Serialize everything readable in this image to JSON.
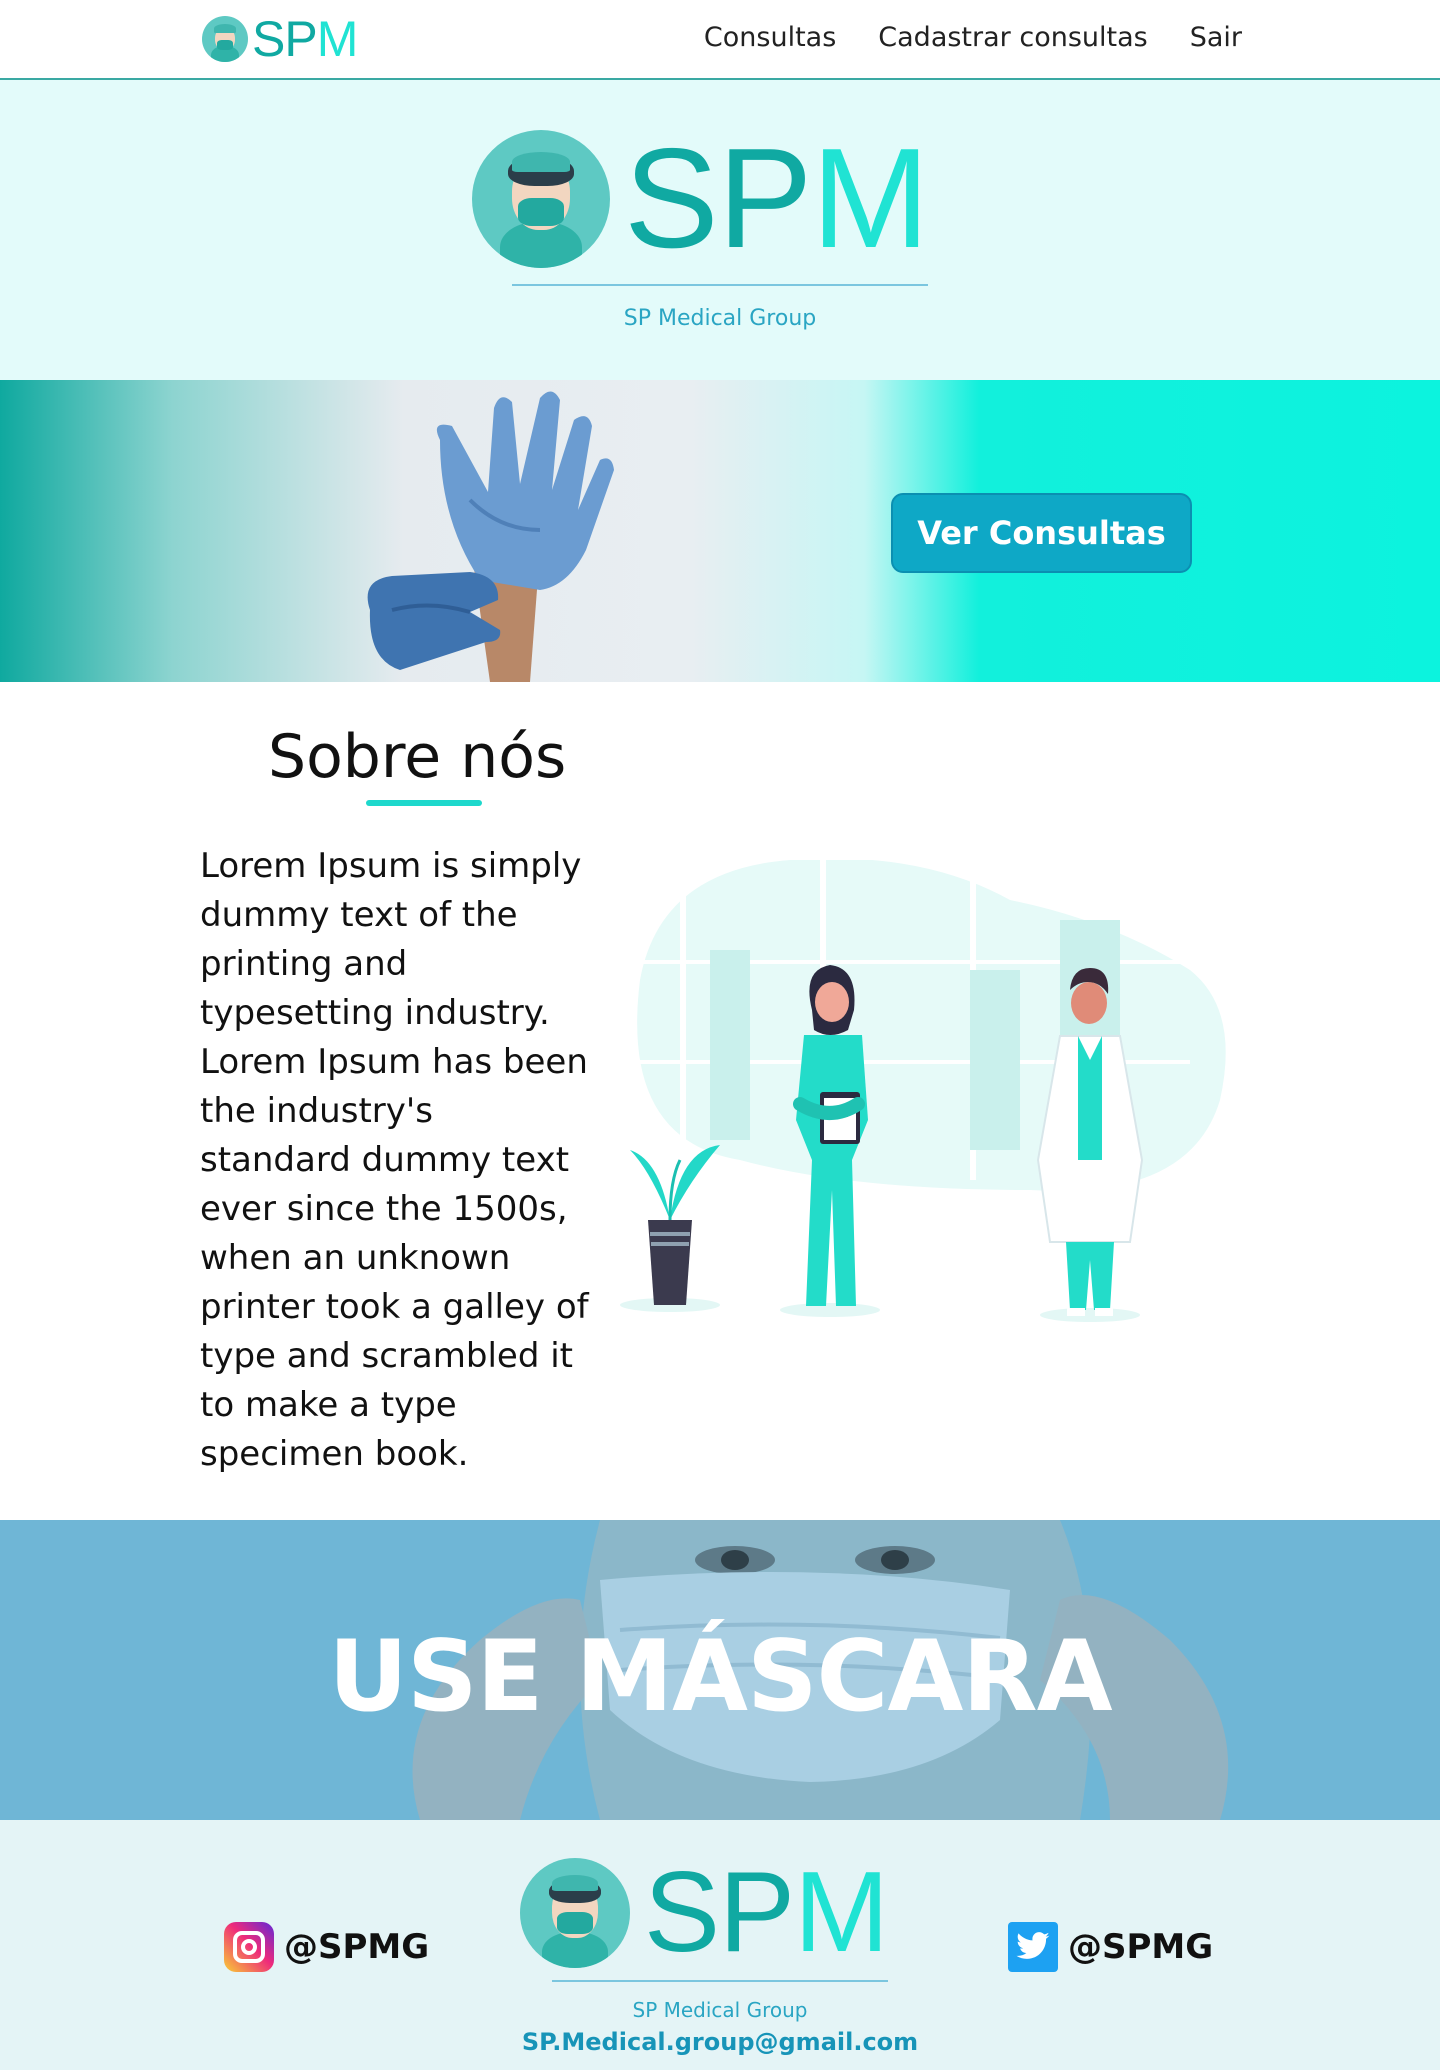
{
  "nav": {
    "logo_s": "SP",
    "logo_m": "M",
    "links": [
      "Consultas",
      "Cadastrar consultas",
      "Sair"
    ]
  },
  "brand": {
    "word_s": "SP",
    "word_m": "M",
    "subtitle": "SP Medical Group"
  },
  "banner": {
    "button_label": "Ver Consultas"
  },
  "about": {
    "title": "Sobre nós",
    "text": "Lorem Ipsum is simply dummy text of the printing and typesetting industry. Lorem Ipsum has been the industry's standard dummy text ever since the 1500s, when an unknown printer took a galley of type and scrambled it to make a type specimen book."
  },
  "mask_banner": {
    "title": "USE MÁSCARA"
  },
  "footer": {
    "instagram_handle": "@SPMG",
    "twitter_handle": "@SPMG",
    "logo_s": "SP",
    "logo_m": "M",
    "subtitle": "SP Medical Group",
    "email": "SP.Medical.group@gmail.com"
  },
  "colors": {
    "accent": "#20e3d3",
    "brand_teal": "#10a9a2",
    "button": "#0ea8c6",
    "brand_band_bg": "#e3fbfa",
    "footer_bg": "#e4f4f6"
  },
  "icons": {
    "logo": "doctor-mask-badge",
    "instagram": "instagram-icon",
    "twitter": "twitter-icon"
  }
}
